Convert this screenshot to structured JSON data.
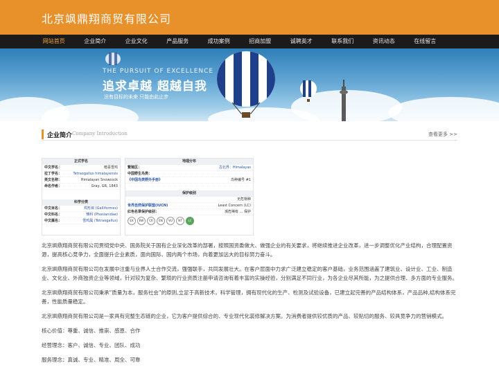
{
  "site": {
    "title": "北京飒鼎翔商贸有限公司"
  },
  "nav": {
    "items": [
      "网站首页",
      "企业简介",
      "企业文化",
      "产品服务",
      "成功案例",
      "招商加盟",
      "诚聘英才",
      "联系我们",
      "资讯动态",
      "在线留言"
    ]
  },
  "banner": {
    "en": "THE PURSUIT OF EXCELLENCE",
    "title": "追求卓越  超越自我",
    "subtitle": "没有目标的未来  只能由此止步"
  },
  "section": {
    "title": "企业简介",
    "title_en": "Company Introduction",
    "more": "查看更多 >>"
  },
  "card1": {
    "head_name": "正式学名",
    "rows": [
      {
        "k": "中文学名：",
        "v": "暗喜雪鸡"
      },
      {
        "k": "拉丁学名：",
        "v": "Tetraogallus himalayensis"
      },
      {
        "k": "英文名称：",
        "v": "Himalayan Snowcock"
      },
      {
        "k": "命名作者：",
        "v": "Gray, GR, 1843"
      }
    ],
    "head_class": "科学分类",
    "class_rows": [
      {
        "k": "中文目名：",
        "v": "鸡形目 (Galliformes)"
      },
      {
        "k": "中文科名：",
        "v": "雉科 (Phasianidae)"
      },
      {
        "k": "中文属名：",
        "v": "雪鸡属 (Tetraogallus)"
      }
    ]
  },
  "card2": {
    "head_dist": "地理分布",
    "dist_rows": [
      {
        "k": "繁殖区：",
        "v": "古北界：Himalayas"
      },
      {
        "k": "中国野生鸟类：",
        "v": ""
      },
      {
        "k": "《中国鸟类野外手册》",
        "v": "鸟种编号 #1"
      }
    ],
    "head_protect": "保护级别",
    "protect_rows": [
      {
        "k": "",
        "v": "无危物种"
      },
      {
        "k": "世界自然保护联盟(IUCN)",
        "v": "Least Concern (LC)"
      },
      {
        "k": "红色名录保护级别：",
        "v": "濒危稀有 ... 保护"
      }
    ],
    "status": [
      "EX",
      "EW",
      "CR",
      "EN",
      "VU",
      "NT",
      "LC"
    ]
  },
  "content": {
    "paragraphs": [
      "北京飒鼎翔商贸有限公司贯彻党中央、国务院关于国有企业深化改革的部署，按照国资委做大、做强企业的有关要求，将继续推进企业改革，进一步调整优化产业结构，合理配置资源，提高核心竞争力，全面提升企业素质，面向国际、国内两个市场，向着更加远大的目标努力奋斗。",
      "北京飒鼎翔商贸有限公司在发展中注重与业界人士合作交流，强强联手，共同发展壮大。在客户层面中力求广泛建立稳定的客户基础，业务范围涵盖了建筑业、设计业、工业、制造业、文化业、外商独资企业等领域，针对较为复杂、繁琐的行业资质注册申请咨询有着丰富的实操经验，分别满足不同行业，为各企业尽其所能，为之提供合理、多方面的专业服务。",
      "北京飒鼎翔商贸有限公司秉承“质量为本，服务社会”的原则,立足于高新技术，科学管理，拥有现代化的生产、检测及试验设备，已建立起完善的产品结构体系，产品品种,结构体系完善，性能质量稳定。",
      "北京飒鼎翔商贸有限公司是一家具有完整生态链的企业，它为客户提供综合的、专业现代化装修解决方案。为消费者提供较优质的产品、较贴切的服务、较具竞争力的营销模式。",
      "核心价值：尊重、诚信、推崇、感恩、合作",
      "经营理念：客户、诚信、专业、团队、成功",
      "服务理念：真诚、专业、精准、周全、可靠"
    ]
  }
}
